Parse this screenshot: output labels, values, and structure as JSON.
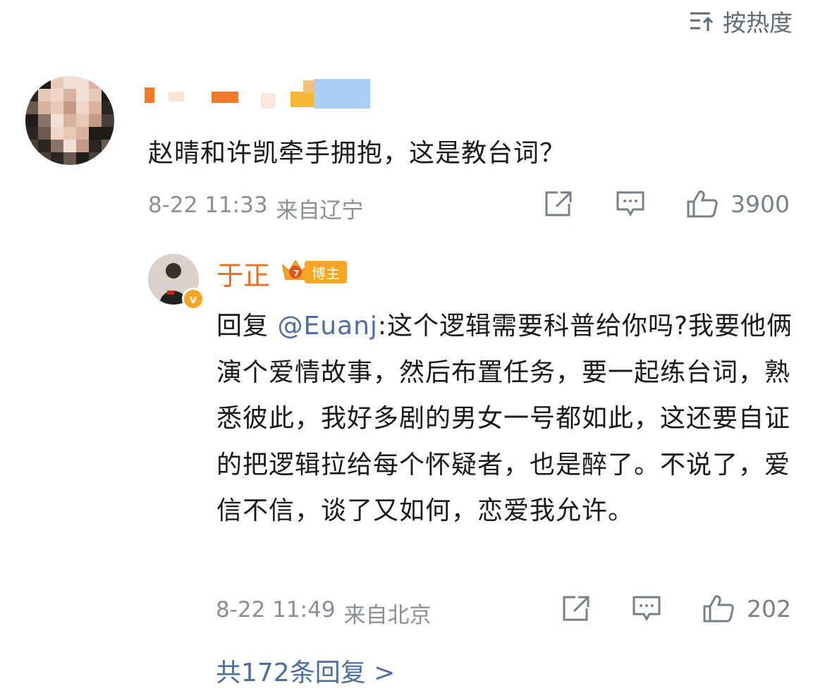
{
  "sort": {
    "label": "按热度",
    "icon": "sort-lines-icon"
  },
  "comment": {
    "text": "赵晴和许凯牵手拥抱，这是教台词？",
    "time": "8-22 11:33",
    "location": "来自辽宁",
    "likes": "3900"
  },
  "reply": {
    "author": "于正",
    "badge": {
      "level": "7",
      "label": "博主",
      "verified": "v"
    },
    "prefix": "回复 ",
    "mention": "@Euanj",
    "text": ":这个逻辑需要科普给你吗?我要他俩演个爱情故事，然后布置任务，要一起练台词，熟悉彼此，我好多剧的男女一号都如此，这还要自证的把逻辑拉给每个怀疑者，也是醉了。不说了，爱信不信，谈了又如何，恋爱我允许。",
    "time": "8-22 11:49",
    "location": "来自北京",
    "likes": "202"
  },
  "more_replies": "共172条回复 >",
  "colors": {
    "accent_name": "#f06a1a",
    "link": "#4e6e9e",
    "badge": "#f6a623",
    "meta": "#8a8f96"
  }
}
